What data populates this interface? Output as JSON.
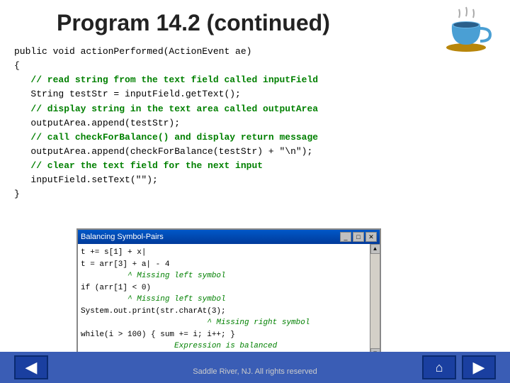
{
  "page": {
    "title": "Program 14.2 (continued)",
    "footer": "Saddle River, NJ. All rights reserved"
  },
  "code": {
    "line1": "public void actionPerformed(ActionEvent ae)",
    "line2": "{",
    "comment1": "   // read string from the text field called inputField",
    "line3": "   String testStr = inputField.getText();",
    "comment2": "   // display string in the text area called outputArea",
    "line4": "   outputArea.append(testStr);",
    "comment3": "   // call checkForBalance() and display return message",
    "line5": "   outputArea.append(checkForBalance(testStr) + \"\\n\");",
    "comment4": "   // clear the text field for the next input",
    "line6": "   inputField.setText(\"\");",
    "line7": "}"
  },
  "window": {
    "title": "Balancing Symbol-Pairs",
    "controls": {
      "minimize": "_",
      "maximize": "□",
      "close": "✕"
    },
    "lines": [
      "t += s[1] + x|",
      "t = arr[3] + a| - 4",
      "          ^ Missing left symbol",
      "if (arr[1] < 0)",
      "          ^ Missing left symbol",
      "System.out.print(str.charAt(3);",
      "                           ^ Missing right symbol",
      "while(i > 100) { sum += i; i++; }",
      "                    Expression is balanced"
    ]
  },
  "nav": {
    "prev_label": "◀",
    "home_label": "⌂",
    "next_label": "▶"
  }
}
